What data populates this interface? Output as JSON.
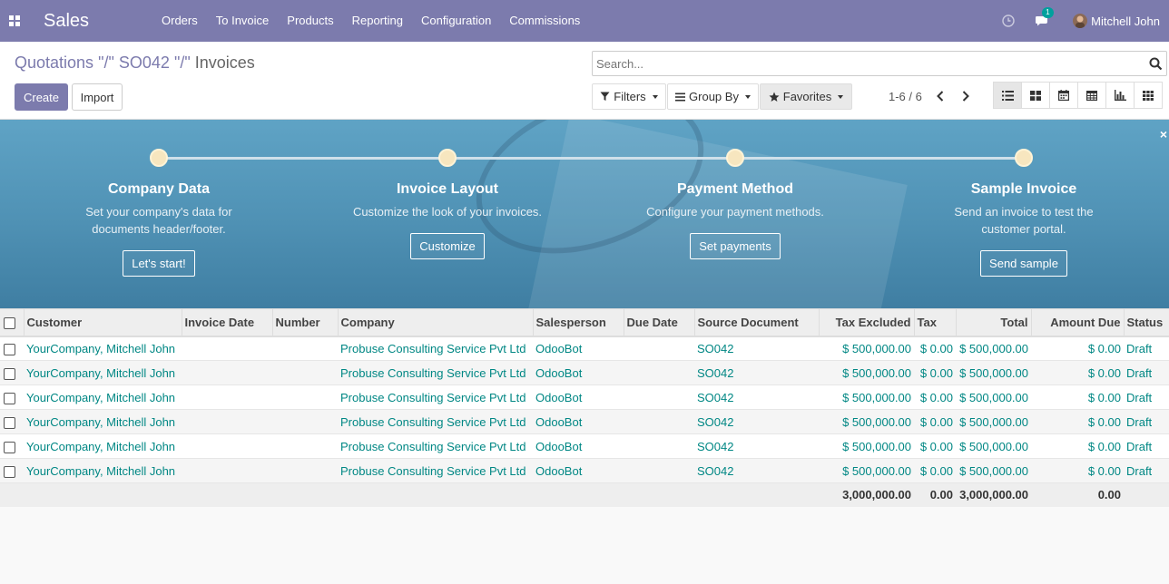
{
  "navbar": {
    "app_name": "Sales",
    "menu": [
      "Orders",
      "To Invoice",
      "Products",
      "Reporting",
      "Configuration",
      "Commissions"
    ],
    "chat_badge": "1",
    "user_name": "Mitchell John",
    "color": "#7c7bad"
  },
  "breadcrumb": {
    "items": [
      "Quotations",
      "\"/\"",
      "SO042",
      "\"/\""
    ],
    "current": "Invoices"
  },
  "buttons": {
    "create": "Create",
    "import": "Import"
  },
  "search": {
    "placeholder": "Search..."
  },
  "filters": {
    "filters": "Filters",
    "group_by": "Group By",
    "favorites": "Favorites"
  },
  "pager": {
    "text": "1-6 / 6"
  },
  "views": [
    "list-icon",
    "kanban-icon",
    "calendar-icon",
    "pivot-icon",
    "graph-icon",
    "activity-icon"
  ],
  "banner": {
    "steps": [
      {
        "title": "Company Data",
        "desc": "Set your company's data for documents header/footer.",
        "button": "Let's start!"
      },
      {
        "title": "Invoice Layout",
        "desc": "Customize the look of your invoices.",
        "button": "Customize"
      },
      {
        "title": "Payment Method",
        "desc": "Configure your payment methods.",
        "button": "Set payments"
      },
      {
        "title": "Sample Invoice",
        "desc": "Send an invoice to test the customer portal.",
        "button": "Send sample"
      }
    ],
    "close": "×"
  },
  "table": {
    "columns": [
      "Customer",
      "Invoice Date",
      "Number",
      "Company",
      "Salesperson",
      "Due Date",
      "Source Document",
      "Tax Excluded",
      "Tax",
      "Total",
      "Amount Due",
      "Status"
    ],
    "rows": [
      [
        "YourCompany, Mitchell John",
        "",
        "",
        "Probuse Consulting Service Pvt Ltd",
        "OdooBot",
        "",
        "SO042",
        "$ 500,000.00",
        "$ 0.00",
        "$ 500,000.00",
        "$ 0.00",
        "Draft"
      ],
      [
        "YourCompany, Mitchell John",
        "",
        "",
        "Probuse Consulting Service Pvt Ltd",
        "OdooBot",
        "",
        "SO042",
        "$ 500,000.00",
        "$ 0.00",
        "$ 500,000.00",
        "$ 0.00",
        "Draft"
      ],
      [
        "YourCompany, Mitchell John",
        "",
        "",
        "Probuse Consulting Service Pvt Ltd",
        "OdooBot",
        "",
        "SO042",
        "$ 500,000.00",
        "$ 0.00",
        "$ 500,000.00",
        "$ 0.00",
        "Draft"
      ],
      [
        "YourCompany, Mitchell John",
        "",
        "",
        "Probuse Consulting Service Pvt Ltd",
        "OdooBot",
        "",
        "SO042",
        "$ 500,000.00",
        "$ 0.00",
        "$ 500,000.00",
        "$ 0.00",
        "Draft"
      ],
      [
        "YourCompany, Mitchell John",
        "",
        "",
        "Probuse Consulting Service Pvt Ltd",
        "OdooBot",
        "",
        "SO042",
        "$ 500,000.00",
        "$ 0.00",
        "$ 500,000.00",
        "$ 0.00",
        "Draft"
      ],
      [
        "YourCompany, Mitchell John",
        "",
        "",
        "Probuse Consulting Service Pvt Ltd",
        "OdooBot",
        "",
        "SO042",
        "$ 500,000.00",
        "$ 0.00",
        "$ 500,000.00",
        "$ 0.00",
        "Draft"
      ]
    ],
    "totals": {
      "tax_excluded": "3,000,000.00",
      "tax": "0.00",
      "total": "3,000,000.00",
      "amount_due": "0.00"
    },
    "link_color": "#008784"
  }
}
